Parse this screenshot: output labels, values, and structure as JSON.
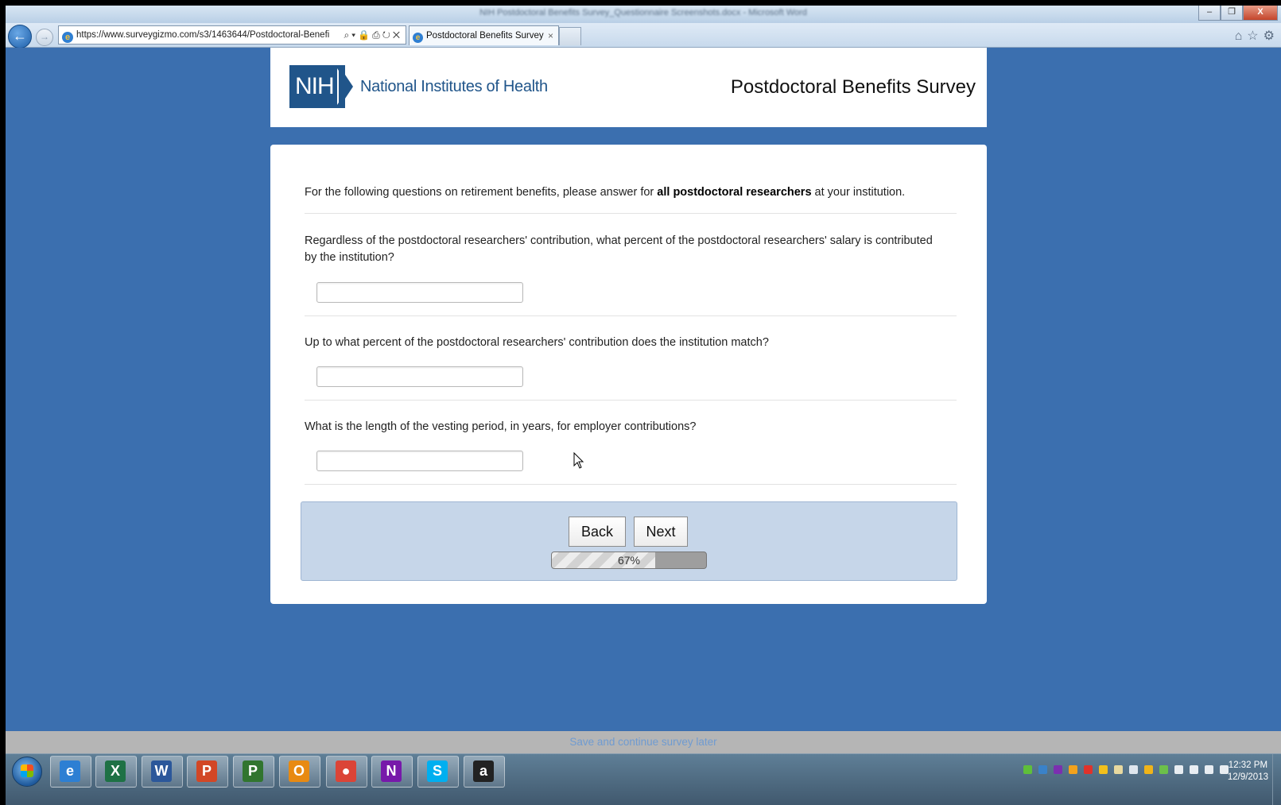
{
  "window": {
    "title": "NIH Postdoctoral Benefits Survey_Questionnaire Screenshots.docx - Microsoft Word",
    "minimize": "–",
    "restore": "❐",
    "close": "X"
  },
  "browser": {
    "url": "https://www.surveygizmo.com/s3/1463644/Postdoctoral-Benefi",
    "address_tools": "⌕▾🔒⎙↻✕",
    "tab_title": "Postdoctoral Benefits Survey",
    "tab_close": "×",
    "back_glyph": "←",
    "forward_glyph": "→",
    "right_icons": "⌂☆⚙"
  },
  "header": {
    "logo_text": "NIH",
    "org_name": "National Institutes of Health",
    "survey_title": "Postdoctoral Benefits Survey"
  },
  "form": {
    "intro_before": "For the following questions on retirement benefits, please answer for ",
    "intro_bold": "all postdoctoral researchers",
    "intro_after": " at your institution.",
    "questions": [
      {
        "text": "Regardless of the postdoctoral researchers' contribution, what percent of the postdoctoral researchers' salary is contributed by the institution?",
        "value": ""
      },
      {
        "text": "Up to what percent of the postdoctoral researchers' contribution does the institution match?",
        "value": ""
      },
      {
        "text": "What is the length of the vesting period, in years, for employer contributions?",
        "value": ""
      }
    ],
    "back_label": "Back",
    "next_label": "Next",
    "progress_label": "67%",
    "progress_value": 0.67
  },
  "footer": {
    "save_link": "Save and continue survey later"
  },
  "taskbar": {
    "apps": [
      {
        "name": "internet-explorer",
        "glyph": "e",
        "color": "#2d7fd3"
      },
      {
        "name": "excel",
        "glyph": "X",
        "color": "#1e7145"
      },
      {
        "name": "word",
        "glyph": "W",
        "color": "#2b579a"
      },
      {
        "name": "powerpoint",
        "glyph": "P",
        "color": "#d24726"
      },
      {
        "name": "project",
        "glyph": "P",
        "color": "#31752f"
      },
      {
        "name": "outlook",
        "glyph": "O",
        "color": "#e88a12"
      },
      {
        "name": "chrome",
        "glyph": "●",
        "color": "#db4437"
      },
      {
        "name": "onenote",
        "glyph": "N",
        "color": "#7719aa"
      },
      {
        "name": "skype",
        "glyph": "S",
        "color": "#00aff0"
      },
      {
        "name": "amazon",
        "glyph": "a",
        "color": "#222222"
      }
    ],
    "clock_time": "12:32 PM",
    "clock_date": "12/9/2013"
  },
  "colors": {
    "page_background": "#3b6faf",
    "nih_blue": "#20558a",
    "nav_panel": "#c6d6e9",
    "save_link": "#6f9bd1"
  }
}
